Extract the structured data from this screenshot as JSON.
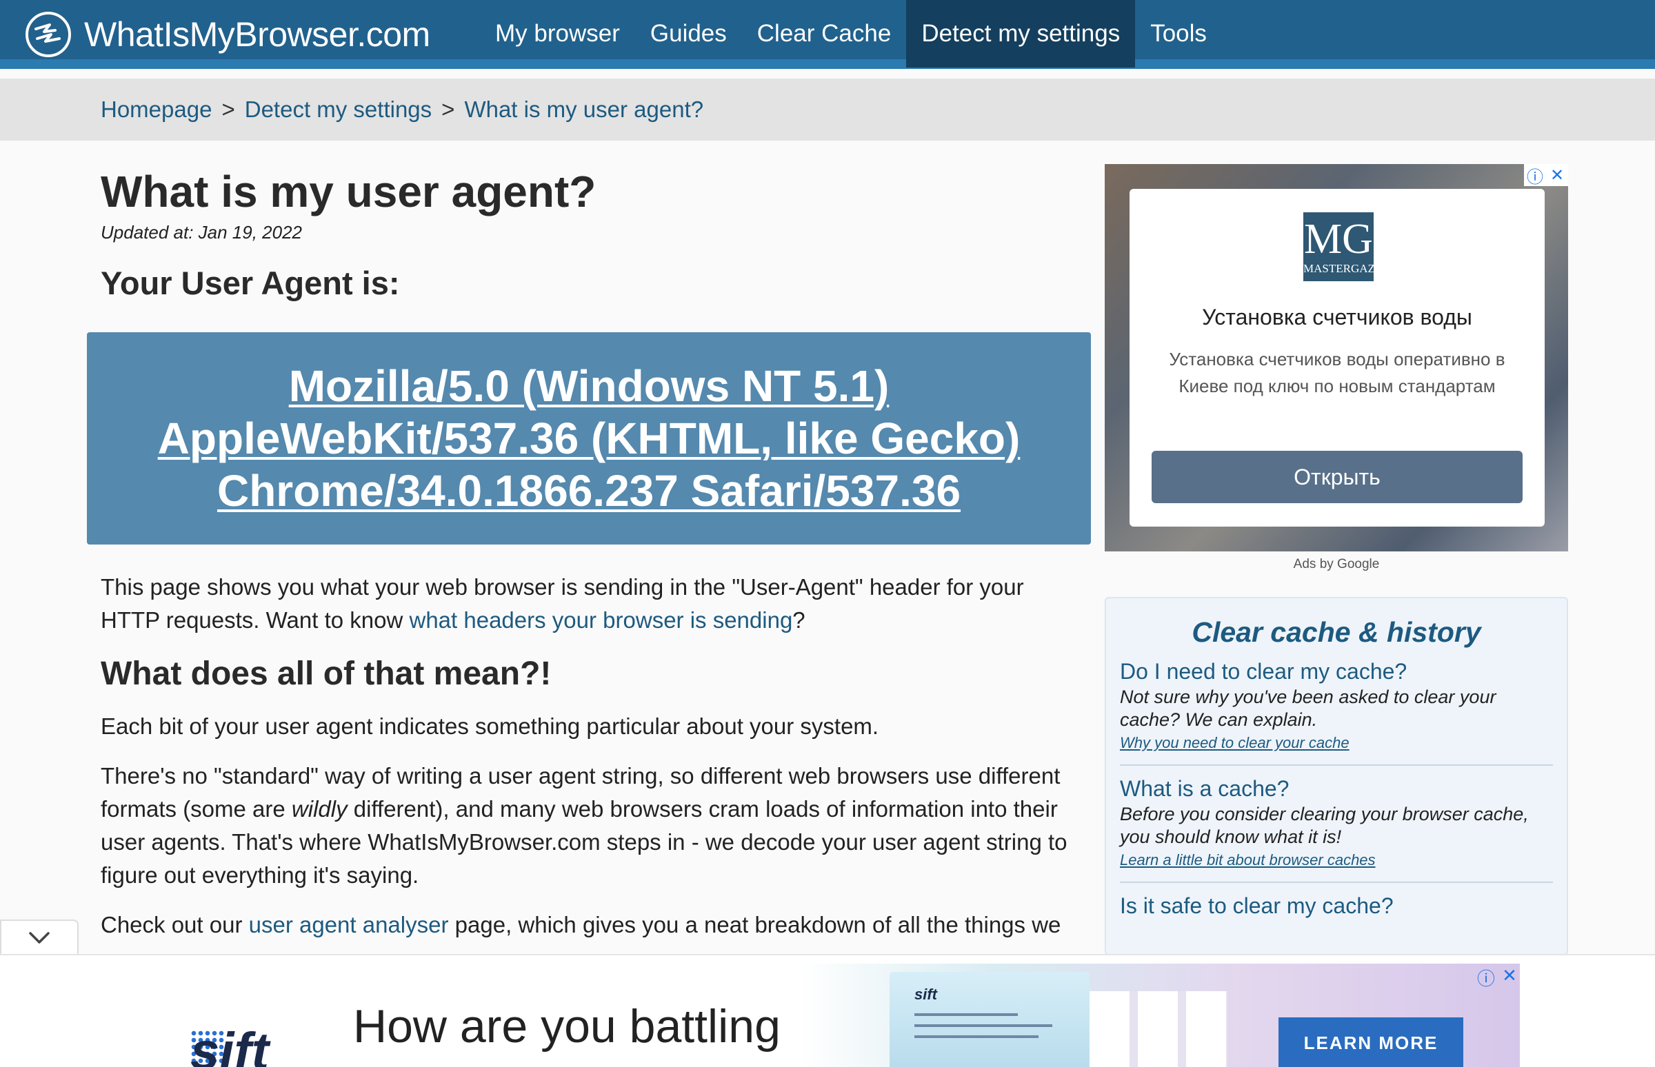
{
  "site": {
    "name": "WhatIsMyBrowser.com"
  },
  "nav": {
    "items": [
      {
        "label": "My browser",
        "active": false
      },
      {
        "label": "Guides",
        "active": false
      },
      {
        "label": "Clear Cache",
        "active": false
      },
      {
        "label": "Detect my settings",
        "active": true
      },
      {
        "label": "Tools",
        "active": false
      }
    ]
  },
  "breadcrumb": {
    "items": [
      "Homepage",
      "Detect my settings",
      "What is my user agent?"
    ],
    "separator": ">"
  },
  "main": {
    "title": "What is my user agent?",
    "updated": "Updated at: Jan 19, 2022",
    "ua_heading": "Your User Agent is:",
    "user_agent": "Mozilla/5.0 (Windows NT 5.1) AppleWebKit/537.36 (KHTML, like Gecko) Chrome/34.0.1866.237 Safari/537.36",
    "intro_before": "This page shows you what your web browser is sending in the \"User-Agent\" header for your HTTP requests. Want to know ",
    "intro_link": "what headers your browser is sending",
    "intro_after": "?",
    "section_heading": "What does all of that mean?!",
    "para1": "Each bit of your user agent indicates something particular about your system.",
    "para2_before": "There's no \"standard\" way of writing a user agent string, so different web browsers use different formats (some are ",
    "para2_em": "wildly",
    "para2_after": " different), and many web browsers cram loads of information into their user agents. That's where WhatIsMyBrowser.com steps in - we decode your user agent string to figure out everything it's saying.",
    "para3_before": "Check out our ",
    "para3_link": "user agent analyser",
    "para3_after": " page, which gives you a neat breakdown of all the things we"
  },
  "sidebar_ad": {
    "logo_big": "MG",
    "logo_small": "MASTERGAZ",
    "title": "Установка счетчиков воды",
    "description": "Установка счетчиков воды оперативно в Киеве под ключ по новым стандартам",
    "button": "Открыть",
    "ads_by": "Ads by Google"
  },
  "cache_box": {
    "title": "Clear cache & history",
    "items": [
      {
        "question": "Do I need to clear my cache?",
        "answer": "Not sure why you've been asked to clear your cache? We can explain.",
        "link": "Why you need to clear your cache"
      },
      {
        "question": "What is a cache?",
        "answer": "Before you consider clearing your browser cache, you should know what it is!",
        "link": "Learn a little bit about browser caches"
      },
      {
        "question": "Is it safe to clear my cache?",
        "answer": "",
        "link": ""
      }
    ]
  },
  "bottom_ad": {
    "brand": "sift",
    "headline": "How are you battling",
    "promo_tag": "sift",
    "cta": "LEARN MORE"
  },
  "colors": {
    "nav_bg": "#21618d",
    "nav_active": "#143f5e",
    "ua_box": "#5589ae",
    "link": "#1d5a80"
  }
}
